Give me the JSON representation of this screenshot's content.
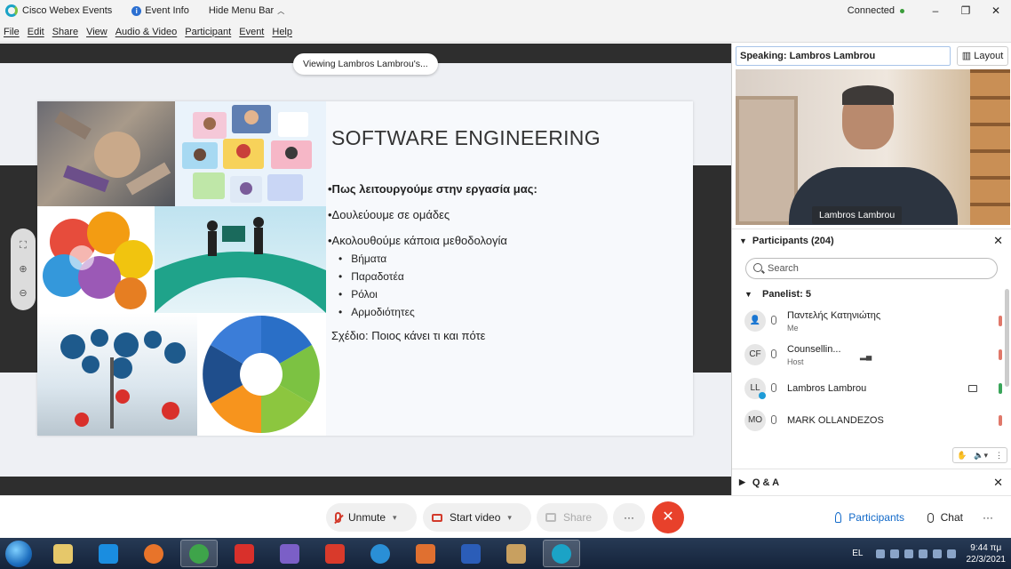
{
  "titlebar": {
    "app_name": "Cisco Webex Events",
    "event_info": "Event Info",
    "hide_menu": "Hide Menu Bar",
    "status": "Connected",
    "minimize": "–",
    "restore": "❐",
    "close": "✕"
  },
  "menu": [
    "File",
    "Edit",
    "Share",
    "View",
    "Audio & Video",
    "Participant",
    "Event",
    "Help"
  ],
  "stage": {
    "viewing_label": "Viewing Lambros Lambrou's..."
  },
  "slide": {
    "title": "SOFTWARE ENGINEERING",
    "bullet_1": "•Πως λειτουργούμε στην εργασία μας:",
    "bullet_2": "•Δουλεύουμε σε ομάδες",
    "bullet_3": "•Ακολουθούμε κάποια μεθοδολογία",
    "sub_items": [
      "Βήματα",
      "Παραδοτέα",
      "Ρόλοι",
      "Αρμοδιότητες"
    ],
    "plan": "Σχέδιο: Ποιος κάνει τι και πότε"
  },
  "right_panel": {
    "speaking": "Speaking: Lambros Lambrou",
    "layout": "Layout",
    "video_name": "Lambros Lambrou",
    "participants_header": "Participants (204)",
    "search_placeholder": "Search",
    "panelist_header": "Panelist: 5",
    "participants": [
      {
        "initials": "",
        "name": "Παντελής Κατηνιώτης",
        "role": "Me"
      },
      {
        "initials": "CF",
        "name": "Counsellin...",
        "role": "Host"
      },
      {
        "initials": "LL",
        "name": "Lambros Lambrou",
        "role": ""
      },
      {
        "initials": "MO",
        "name": "MARK OLLANDEZOS",
        "role": ""
      }
    ],
    "qa_header": "Q & A"
  },
  "controls": {
    "unmute": "Unmute",
    "start_video": "Start video",
    "share": "Share",
    "more": "···",
    "leave": "✕",
    "participants": "Participants",
    "chat": "Chat",
    "panel_more": "···"
  },
  "taskbar": {
    "lang": "EL",
    "time": "9:44 πμ",
    "date": "22/3/2021",
    "app_colors": [
      "#e6c86a",
      "#1a8de0",
      "#e8742a",
      "#3ea44a",
      "#d9302b",
      "#7b5fc7",
      "#d93a2b",
      "#2a8fd6",
      "#e07030",
      "#2b5db8",
      "#c8a060",
      "#1ba3c6"
    ]
  }
}
